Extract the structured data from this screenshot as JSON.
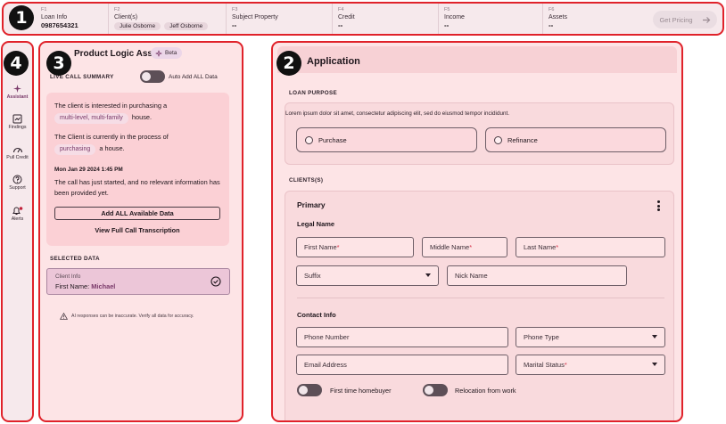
{
  "markers": [
    "1",
    "2",
    "3",
    "4"
  ],
  "topbar": {
    "loan": {
      "key": "F1",
      "label": "Loan Info",
      "value": "0987654321"
    },
    "clients": {
      "key": "F2",
      "label": "Client(s)",
      "chips": [
        "Julie Osborne",
        "Jeff Osborne"
      ]
    },
    "property": {
      "key": "F3",
      "label": "Subject Property",
      "value": "--"
    },
    "credit": {
      "key": "F4",
      "label": "Credit",
      "value": "--"
    },
    "income": {
      "key": "F5",
      "label": "Income",
      "value": "--"
    },
    "assets": {
      "key": "F6",
      "label": "Assets",
      "value": "--"
    },
    "get_pricing": "Get Pricing",
    "get_pricing_icon": "arrow-right-icon"
  },
  "rail": {
    "items": [
      {
        "label": "Assistant",
        "icon": "sparkle-icon",
        "active": true
      },
      {
        "label": "Findings",
        "icon": "findings-icon",
        "active": false
      },
      {
        "label": "Pull Credit",
        "icon": "gauge-icon",
        "active": false
      },
      {
        "label": "Support",
        "icon": "help-icon",
        "active": false
      },
      {
        "label": "Alerts",
        "icon": "bell-icon",
        "active": false
      }
    ]
  },
  "assistant": {
    "title": "Product Logic Assistant",
    "beta": "Beta",
    "live_call_label": "LIVE CALL SUMMARY",
    "auto_add_label": "Auto Add ALL Data",
    "sentence1_pre": "The client is interested in purchasing a",
    "sentence1_pill": "multi-level, multi-family",
    "sentence1_post": "house.",
    "sentence2_pre": "The Client is currently in the process of",
    "sentence2_pill": "purchasing",
    "sentence2_post": "a house.",
    "timestamp": "Mon Jan 29 2024 1:45 PM",
    "call_note": "The call has just started, and no relevant information has been provided yet.",
    "add_all": "Add ALL Available Data",
    "view_full": "View Full Call Transcription",
    "selected_label": "SELECTED DATA",
    "selected_card": {
      "title": "Client Info",
      "field": "First Name:",
      "value": "Michael"
    },
    "disclaimer": "AI responses can be inaccurate. Verify all data for accuracy."
  },
  "application": {
    "title": "Application",
    "loan_purpose_label": "LOAN PURPOSE",
    "lorem": "Lorem ipsum dolor sit amet, consectetur adipiscing elit, sed do eiusmod tempor incididunt.",
    "purchase": "Purchase",
    "refinance": "Refinance",
    "clients_label": "CLIENTS(S)",
    "primary": "Primary",
    "legal_name": "Legal Name",
    "first_name": "First Name",
    "middle_name": "Middle Name",
    "last_name": "Last Name",
    "required_mark": "*",
    "suffix": "Suffix",
    "nick_name": "Nick Name",
    "contact_info": "Contact Info",
    "phone_number": "Phone Number",
    "phone_type": "Phone Type",
    "email_address": "Email Address",
    "marital_status": "Marital Status",
    "first_time": "First time homebuyer",
    "relocation": "Relocation from work"
  }
}
